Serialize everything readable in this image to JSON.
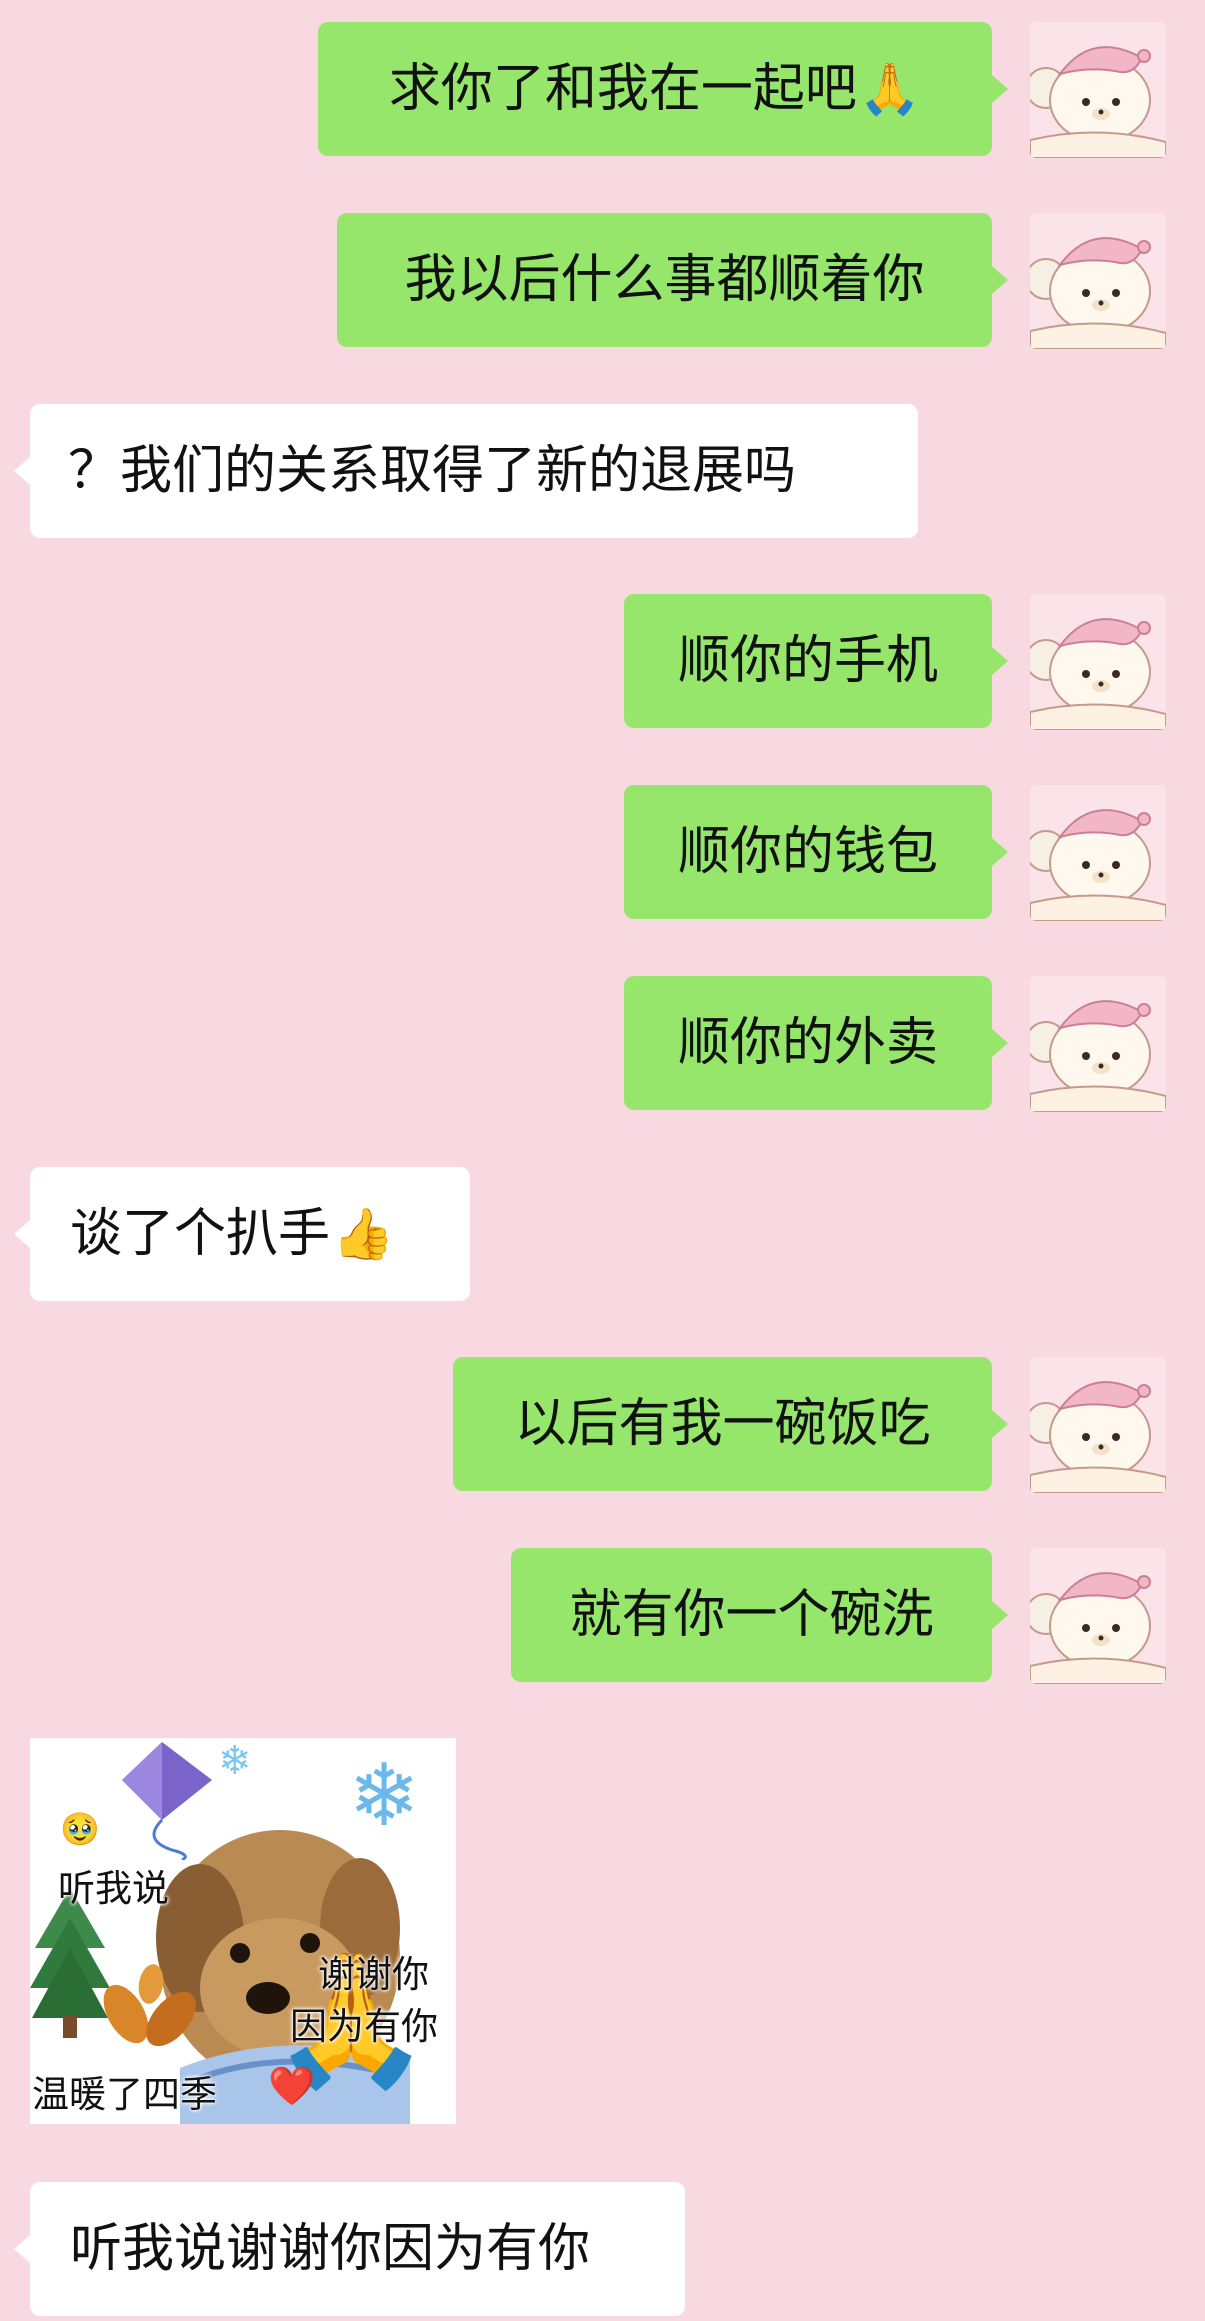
{
  "colors": {
    "background": "#f9d9e1",
    "sent_bubble": "#95e66a",
    "received_bubble": "#ffffff"
  },
  "messages": [
    {
      "direction": "sent",
      "text": "求你了和我在一起吧",
      "emoji": "🙏"
    },
    {
      "direction": "sent",
      "text": "我以后什么事都顺着你"
    },
    {
      "direction": "received",
      "text": "？我们的关系取得了新的退展吗"
    },
    {
      "direction": "sent",
      "text": "顺你的手机"
    },
    {
      "direction": "sent",
      "text": "顺你的钱包"
    },
    {
      "direction": "sent",
      "text": "顺你的外卖"
    },
    {
      "direction": "received",
      "text": "谈了个扒手",
      "emoji": "👍"
    },
    {
      "direction": "sent",
      "text": "以后有我一碗饭吃"
    },
    {
      "direction": "sent",
      "text": "就有你一个碗洗"
    },
    {
      "direction": "received",
      "type": "sticker"
    },
    {
      "direction": "received",
      "text": "听我说谢谢你因为有你"
    }
  ],
  "sticker": {
    "text_listen": "听我说",
    "text_thanks": "谢谢你",
    "text_because": "因为有你",
    "text_warm": "温暖了四季",
    "heart": "❤️",
    "icons": [
      "kite-icon",
      "snowflake-icon",
      "tree-icon",
      "leaf-icon",
      "praying-hands-icon",
      "puppy-icon"
    ]
  },
  "avatar": {
    "icon": "pink-bear-avatar-icon"
  }
}
